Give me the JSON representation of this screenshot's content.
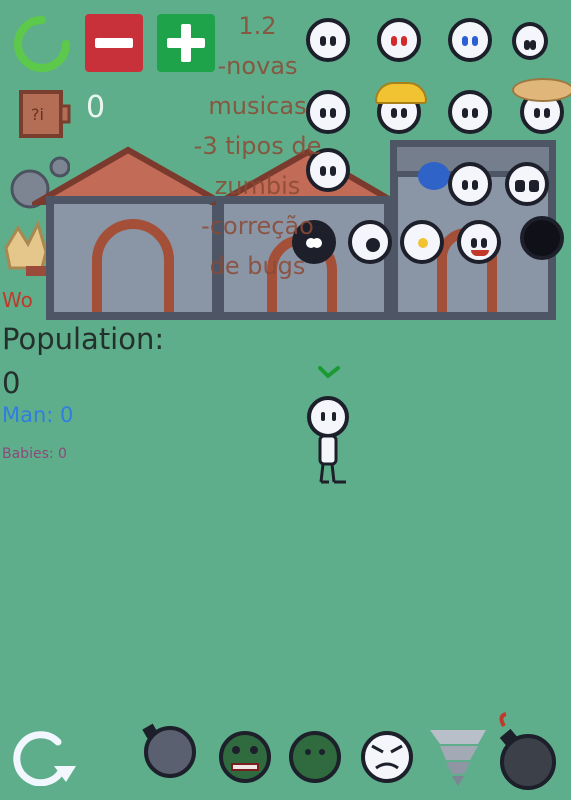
{
  "hud": {
    "coin_count": "0",
    "version_notes": [
      "1.2",
      "-novas",
      "musicas",
      "-3 tipos de",
      "zumbis",
      "-correção",
      "de bugs"
    ]
  },
  "stats": {
    "women_label": "Wo",
    "population_label": "Population: 0",
    "man_label": "Man: 0",
    "babies_label": "Babies: 0"
  },
  "colors": {
    "background": "#5fae8b",
    "minus_button": "#c8303a",
    "plus_button": "#1fa34a",
    "loading_ring": "#5cc94a",
    "house_wall": "#8a95a6",
    "house_roof": "#c26b56"
  },
  "icons": {
    "top_left": [
      "loading-ring-icon",
      "minus-icon",
      "plus-icon"
    ],
    "bottom_bar": [
      "bomb-icon",
      "zombie-icon",
      "zombie-green-icon",
      "angry-face-icon",
      "tornado-icon",
      "bomb-fuse-icon"
    ],
    "refresh": "refresh-icon"
  }
}
